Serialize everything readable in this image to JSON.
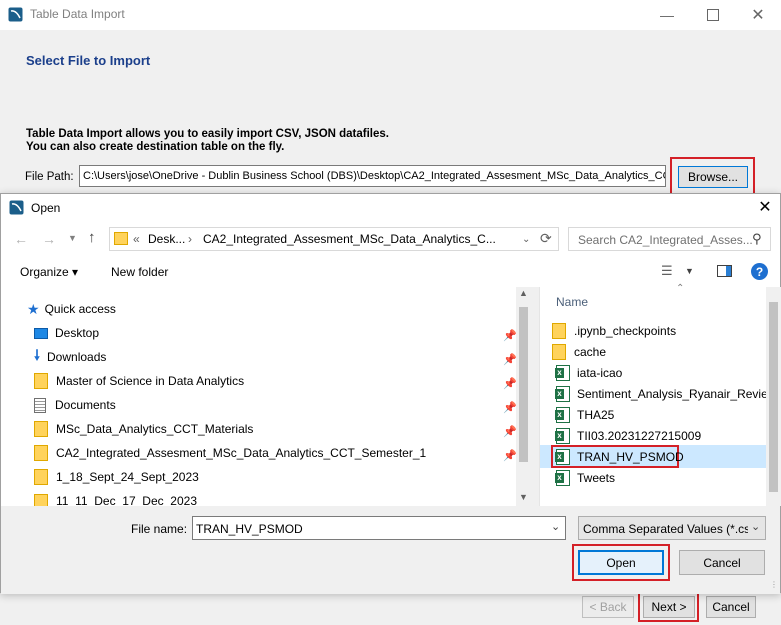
{
  "wizard": {
    "title": "Table Data Import",
    "heading": "Select File to Import",
    "desc_line1": "Table Data Import allows you to easily import CSV, JSON datafiles.",
    "desc_line2": "You can also create destination table on the fly.",
    "file_path_label": "File Path:",
    "file_path_value": "C:\\Users\\jose\\OneDrive - Dublin Business School (DBS)\\Desktop\\CA2_Integrated_Assesment_MSc_Data_Analytics_CCT_",
    "browse_label": "Browse...",
    "back_label": "< Back",
    "next_label": "Next >",
    "cancel_label": "Cancel"
  },
  "dialog": {
    "title": "Open",
    "breadcrumb_prefix": "«",
    "breadcrumb_1": "Desk...",
    "breadcrumb_2": "CA2_Integrated_Assesment_MSc_Data_Analytics_C...",
    "search_placeholder": "Search CA2_Integrated_Asses...",
    "organize_label": "Organize ▾",
    "new_folder_label": "New folder",
    "column_name": "Name",
    "nav_items": [
      {
        "label": "Quick access",
        "icon": "star-icon"
      },
      {
        "label": "Desktop",
        "icon": "desktop-icon",
        "pinned": true
      },
      {
        "label": "Downloads",
        "icon": "download-icon",
        "pinned": true
      },
      {
        "label": "Master of Science in Data Analytics",
        "icon": "folder-icon",
        "pinned": true
      },
      {
        "label": "Documents",
        "icon": "documents-icon",
        "pinned": true
      },
      {
        "label": "MSc_Data_Analytics_CCT_Materials",
        "icon": "folder-icon",
        "pinned": true
      },
      {
        "label": "CA2_Integrated_Assesment_MSc_Data_Analytics_CCT_Semester_1",
        "icon": "folder-icon",
        "pinned": true
      },
      {
        "label": "1_18_Sept_24_Sept_2023",
        "icon": "folder-icon"
      },
      {
        "label": "11_11_Dec_17_Dec_2023",
        "icon": "folder-icon"
      }
    ],
    "files": [
      {
        "label": ".ipynb_checkpoints",
        "type": "folder"
      },
      {
        "label": "cache",
        "type": "folder"
      },
      {
        "label": "iata-icao",
        "type": "excel"
      },
      {
        "label": "Sentiment_Analysis_Ryanair_Reviews",
        "type": "excel"
      },
      {
        "label": "THA25",
        "type": "excel"
      },
      {
        "label": "TII03.20231227215009",
        "type": "excel"
      },
      {
        "label": "TRAN_HV_PSMOD",
        "type": "excel",
        "selected": true
      },
      {
        "label": "Tweets",
        "type": "excel"
      }
    ],
    "file_name_label": "File name:",
    "file_name_value": "TRAN_HV_PSMOD",
    "file_type_value": "Comma Separated Values (*.csv",
    "open_label": "Open",
    "cancel_label": "Cancel"
  },
  "colors": {
    "heading": "#1b3f8b",
    "highlight_outline": "#d42027",
    "selection": "#cce8ff",
    "excel_green": "#1e7145",
    "folder_yellow": "#ffd35c"
  }
}
